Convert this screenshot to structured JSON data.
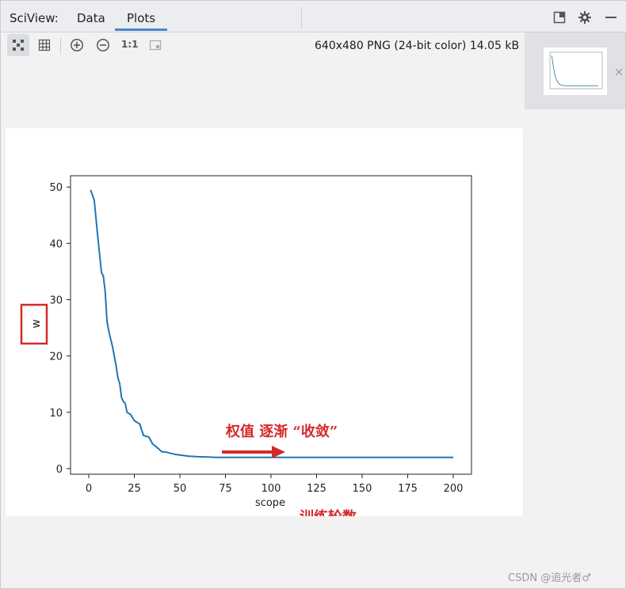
{
  "panel": {
    "title": "SciView:",
    "tabs": [
      {
        "label": "Data",
        "active": false
      },
      {
        "label": "Plots",
        "active": true
      }
    ],
    "header_icons": [
      "restore-layout-icon",
      "gear-icon",
      "minimize-icon"
    ]
  },
  "toolbar": {
    "buttons": [
      "fit-checker-icon",
      "grid-icon",
      "zoom-in-icon",
      "zoom-out-icon",
      "actual-size-icon",
      "fit-window-icon"
    ],
    "actual_size_label": "1:1",
    "image_info": "640x480 PNG (24-bit color) 14.05 kB"
  },
  "colors": {
    "accent": "#4a87d0",
    "line": "#1f77b4",
    "annotation": "#d42a2a"
  },
  "annotations": {
    "convergence": "权值 逐渐 “收敛”",
    "epochs": "训练轮数"
  },
  "chart_data": {
    "type": "line",
    "xlabel": "scope",
    "ylabel": "w",
    "xlim": [
      -10,
      210
    ],
    "ylim": [
      -1,
      52
    ],
    "xticks": [
      0,
      25,
      50,
      75,
      100,
      125,
      150,
      175,
      200
    ],
    "yticks": [
      0,
      10,
      20,
      30,
      40,
      50
    ],
    "grid": false,
    "series": [
      {
        "x": [
          1,
          3,
          5,
          7,
          8,
          9,
          10,
          11,
          13,
          15,
          16,
          17,
          18,
          19,
          20,
          21,
          22,
          23,
          25,
          28,
          30,
          33,
          35,
          38,
          40,
          43,
          45,
          48,
          50,
          55,
          60,
          65,
          70,
          80,
          90,
          100,
          120,
          150,
          180,
          200
        ],
        "y": [
          49.5,
          47.7,
          41.0,
          34.8,
          34.2,
          31.5,
          26.2,
          24.4,
          21.7,
          18.3,
          16.1,
          15.1,
          12.6,
          11.9,
          11.6,
          10.0,
          9.8,
          9.6,
          8.5,
          7.9,
          5.9,
          5.6,
          4.4,
          3.6,
          3.0,
          2.9,
          2.7,
          2.5,
          2.4,
          2.2,
          2.1,
          2.05,
          2.0,
          2.0,
          2.0,
          2.0,
          2.0,
          2.0,
          2.0,
          2.0
        ]
      }
    ]
  },
  "thumbnail": {
    "chart_data": {
      "type": "line",
      "x": [
        1,
        10,
        20,
        30,
        40,
        60,
        100,
        200
      ],
      "y": [
        49.5,
        26.2,
        11.6,
        5.9,
        3.0,
        2.1,
        2.0,
        2.0
      ]
    }
  },
  "watermark": "CSDN @追光者♂"
}
